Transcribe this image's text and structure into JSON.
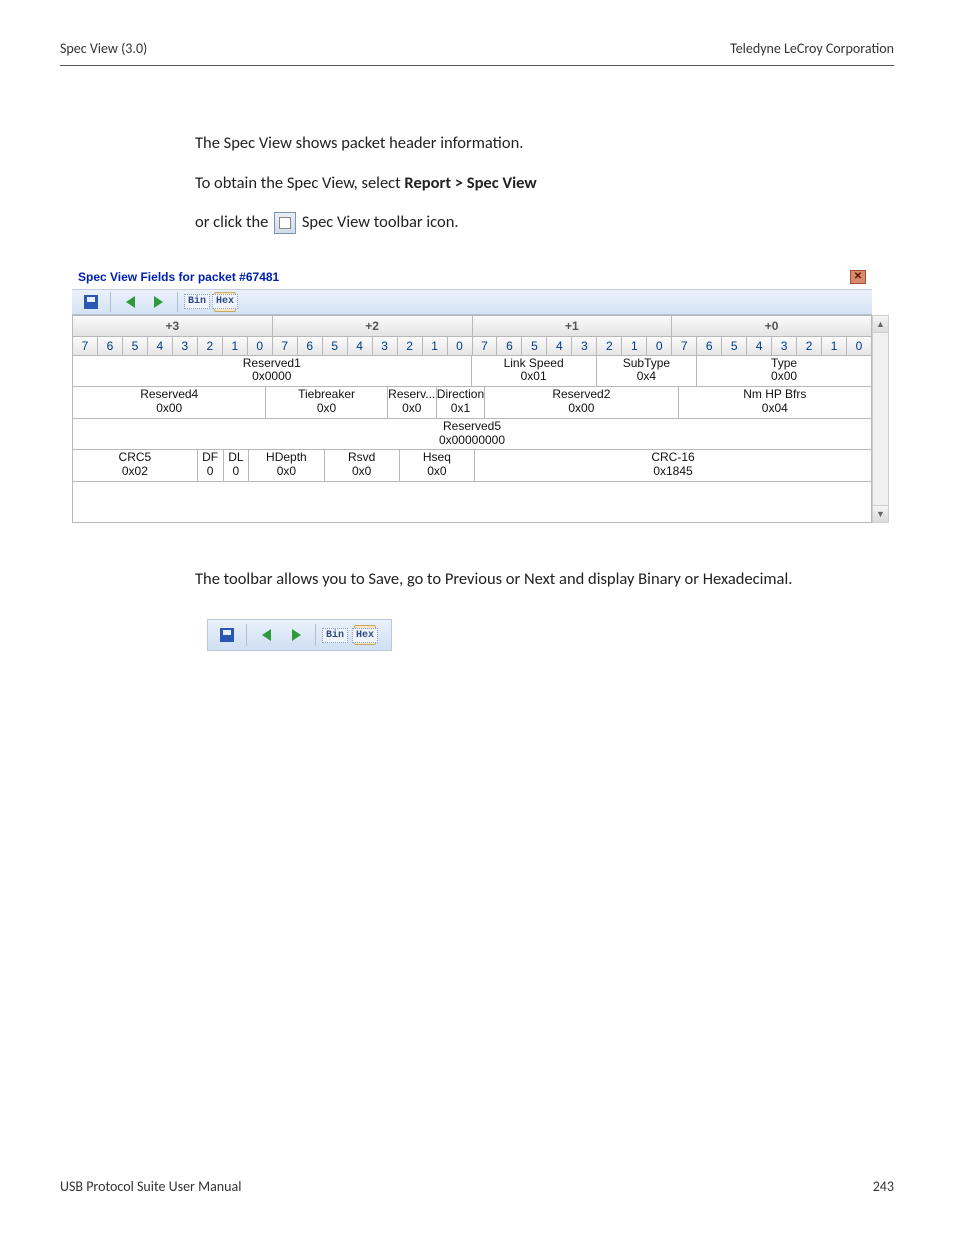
{
  "header": {
    "left": "Spec View (3.0)",
    "right": "Teledyne  LeCroy Corporation"
  },
  "intro": {
    "p1": "The Spec View shows packet header information.",
    "p2_pre": "To obtain the Spec View, select ",
    "p2_bold": "Report > Spec View",
    "p3_pre": "or click the ",
    "p3_post": " Spec View toolbar icon."
  },
  "specwin": {
    "title": "Spec View Fields for packet #67481",
    "toolbar": {
      "bin": "Bin",
      "hex": "Hex"
    },
    "byte_headers": [
      "+3",
      "+2",
      "+1",
      "+0"
    ],
    "bit_pattern": [
      "7",
      "6",
      "5",
      "4",
      "3",
      "2",
      "1",
      "0"
    ],
    "rows": {
      "r1": {
        "reserved1": {
          "label": "Reserved1",
          "value": "0x0000"
        },
        "linkspeed": {
          "label": "Link Speed",
          "value": "0x01"
        },
        "subtype": {
          "label": "SubType",
          "value": "0x4"
        },
        "type": {
          "label": "Type",
          "value": "0x00"
        }
      },
      "r2": {
        "reserved4": {
          "label": "Reserved4",
          "value": "0x00"
        },
        "tiebreaker": {
          "label": "Tiebreaker",
          "value": "0x0"
        },
        "reserv": {
          "label": "Reserv...",
          "value": "0x0"
        },
        "direction": {
          "label": "Direction",
          "value": "0x1"
        },
        "reserved2": {
          "label": "Reserved2",
          "value": "0x00"
        },
        "nmhp": {
          "label": "Nm HP Bfrs",
          "value": "0x04"
        }
      },
      "r3": {
        "reserved5": {
          "label": "Reserved5",
          "value": "0x00000000"
        }
      },
      "r4": {
        "crc5": {
          "label": "CRC5",
          "value": "0x02"
        },
        "df": {
          "label": "DF",
          "value": "0"
        },
        "dl": {
          "label": "DL",
          "value": "0"
        },
        "hdepth": {
          "label": "HDepth",
          "value": "0x0"
        },
        "rsvd": {
          "label": "Rsvd",
          "value": "0x0"
        },
        "hseq": {
          "label": "Hseq",
          "value": "0x0"
        },
        "crc16": {
          "label": "CRC-16",
          "value": "0x1845"
        }
      }
    }
  },
  "after": {
    "p": "The toolbar allows you to Save, go to Previous or Next and display Binary or Hexadecimal."
  },
  "mini": {
    "bin": "Bin",
    "hex": "Hex"
  },
  "footer": {
    "left": "USB Protocol Suite User Manual",
    "right": "243"
  }
}
